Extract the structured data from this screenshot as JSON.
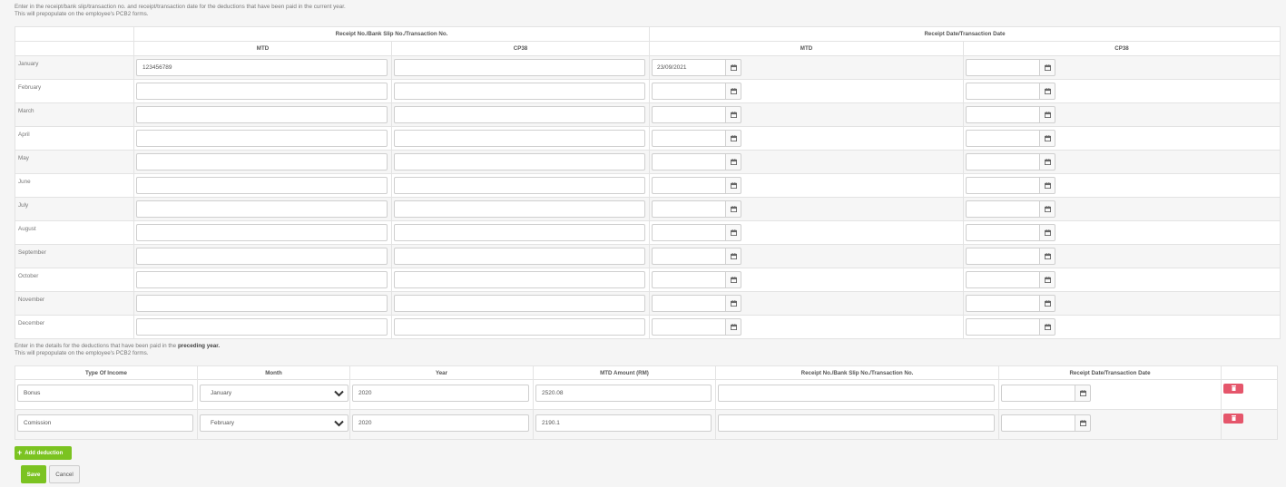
{
  "current": {
    "note_line1": "Enter in the receipt/bank slip/transaction no. and receipt/transaction date for the deductions that have been paid in the current year.",
    "note_line2": "This will prepopulate on the employee's PCB2 forms.",
    "header_receipt_no": "Receipt No./Bank Slip No./Transaction No.",
    "header_receipt_date": "Receipt Date/Transaction Date",
    "sub_mtd": "MTD",
    "sub_cp38": "CP38",
    "months": [
      {
        "name": "January",
        "mtd_no": "123456789",
        "cp38_no": "",
        "mtd_date": "23/09/2021",
        "cp38_date": ""
      },
      {
        "name": "February",
        "mtd_no": "",
        "cp38_no": "",
        "mtd_date": "",
        "cp38_date": ""
      },
      {
        "name": "March",
        "mtd_no": "",
        "cp38_no": "",
        "mtd_date": "",
        "cp38_date": ""
      },
      {
        "name": "April",
        "mtd_no": "",
        "cp38_no": "",
        "mtd_date": "",
        "cp38_date": ""
      },
      {
        "name": "May",
        "mtd_no": "",
        "cp38_no": "",
        "mtd_date": "",
        "cp38_date": ""
      },
      {
        "name": "June",
        "mtd_no": "",
        "cp38_no": "",
        "mtd_date": "",
        "cp38_date": ""
      },
      {
        "name": "July",
        "mtd_no": "",
        "cp38_no": "",
        "mtd_date": "",
        "cp38_date": ""
      },
      {
        "name": "August",
        "mtd_no": "",
        "cp38_no": "",
        "mtd_date": "",
        "cp38_date": ""
      },
      {
        "name": "September",
        "mtd_no": "",
        "cp38_no": "",
        "mtd_date": "",
        "cp38_date": ""
      },
      {
        "name": "October",
        "mtd_no": "",
        "cp38_no": "",
        "mtd_date": "",
        "cp38_date": ""
      },
      {
        "name": "November",
        "mtd_no": "",
        "cp38_no": "",
        "mtd_date": "",
        "cp38_date": ""
      },
      {
        "name": "December",
        "mtd_no": "",
        "cp38_no": "",
        "mtd_date": "",
        "cp38_date": ""
      }
    ]
  },
  "preceding": {
    "note_prefix": "Enter in the details for the deductions that have been paid in the ",
    "note_bold": "preceding year.",
    "note_line2": "This will prepopulate on the employee's PCB2 forms.",
    "headers": [
      "Type Of Income",
      "Month",
      "Year",
      "MTD Amount (RM)",
      "Receipt No./Bank Slip No./Transaction No.",
      "Receipt Date/Transaction Date"
    ],
    "rows": [
      {
        "type": "Bonus",
        "month": "January",
        "year": "2020",
        "amount": "2520.08",
        "receipt_no": "",
        "receipt_date": ""
      },
      {
        "type": "Comission",
        "month": "February",
        "year": "2020",
        "amount": "2190.1",
        "receipt_no": "",
        "receipt_date": ""
      }
    ]
  },
  "buttons": {
    "add_deduction": "Add deduction",
    "add_icon": "plus-icon",
    "save": "Save",
    "cancel": "Cancel"
  },
  "icons": {
    "date_picker": "calendar-icon",
    "delete": "trash-icon",
    "dropdown": "chevron-down-icon"
  },
  "colors": {
    "primary": "#7bc321",
    "danger": "#e5566b"
  }
}
